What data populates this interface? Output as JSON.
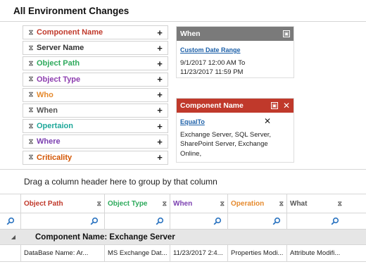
{
  "page": {
    "title": "All Environment Changes"
  },
  "filters": [
    {
      "label": "Component Name",
      "color": "#c0392b"
    },
    {
      "label": "Server Name",
      "color": "#333333"
    },
    {
      "label": "Object Path",
      "color": "#2eaa5c"
    },
    {
      "label": "Object Type",
      "color": "#8e3fb0"
    },
    {
      "label": "Who",
      "color": "#e58a2e"
    },
    {
      "label": "When",
      "color": "#555555"
    },
    {
      "label": "Opertaion",
      "color": "#1fa89a"
    },
    {
      "label": "Where",
      "color": "#7b3fb0"
    },
    {
      "label": "Criticality",
      "color": "#d35400"
    }
  ],
  "when_panel": {
    "title": "When",
    "header_color": "#7a7a7a",
    "link": "Custom Date Range",
    "line1": "9/1/2017 12:00 AM To",
    "line2": "11/23/2017 11:59 PM"
  },
  "component_panel": {
    "title": "Component Name",
    "header_color": "#c0392b",
    "link": "EqualTo",
    "text": "Exchange Server, SQL Server, SharePoint Server, Exchange Online,"
  },
  "grid": {
    "group_hint": "Drag a column header here to group by that column",
    "columns": [
      {
        "label": "Object Path",
        "color": "#c0392b"
      },
      {
        "label": "Object Type",
        "color": "#2eaa5c"
      },
      {
        "label": "When",
        "color": "#7b3fb0"
      },
      {
        "label": "Operation",
        "color": "#e58a2e"
      },
      {
        "label": "What",
        "color": "#555555"
      }
    ],
    "group_label": "Component Name: Exchange Server",
    "rows": [
      [
        "DataBase Name: Ar...",
        "MS Exchange Dat...",
        "11/23/2017 2:4...",
        "Properties Modi...",
        "Attribute Modifi..."
      ]
    ]
  }
}
